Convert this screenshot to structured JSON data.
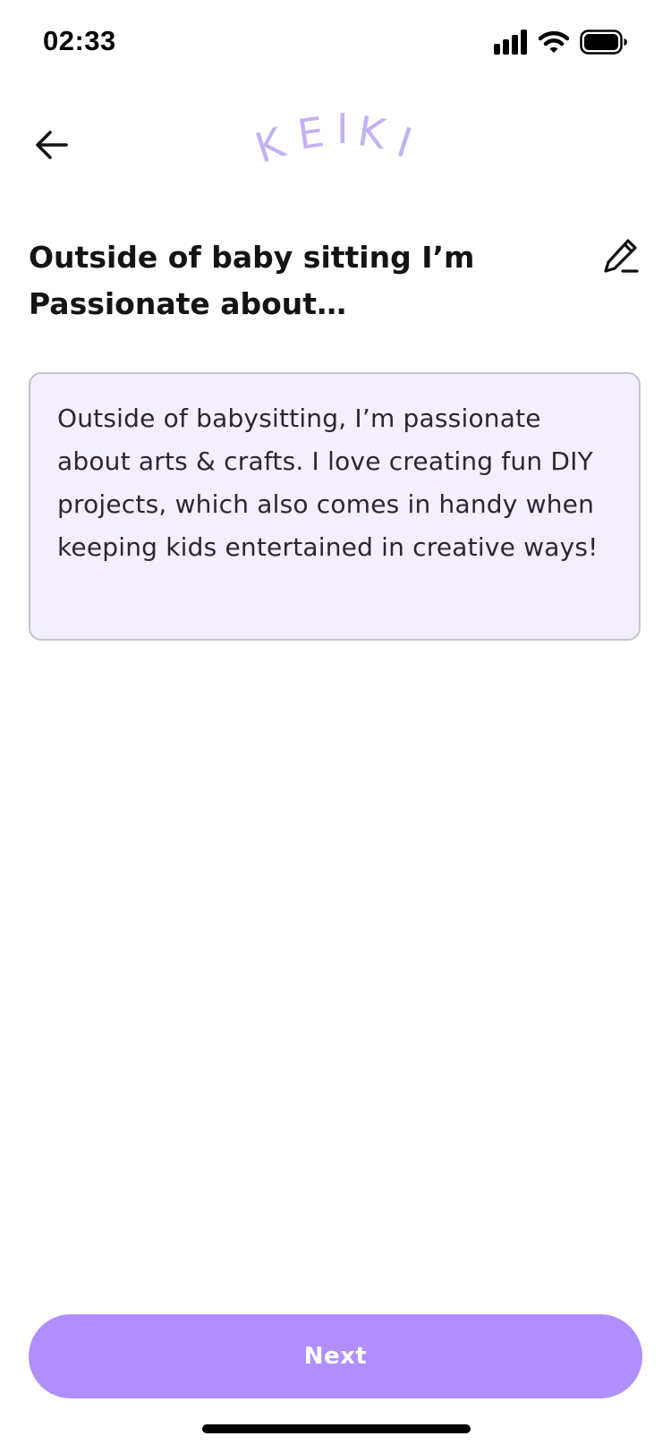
{
  "status_bar": {
    "time": "02:33",
    "icons": [
      "signal-icon",
      "wifi-icon",
      "battery-icon"
    ]
  },
  "header": {
    "back_icon": "back-arrow-icon",
    "logo_text": "KEIKI",
    "logo_color": "#c3b2f2"
  },
  "question": {
    "title": "Outside of baby sitting I’m Passionate about…",
    "edit_icon": "pencil-icon"
  },
  "answer": {
    "text": "Outside of babysitting, I’m passionate about arts & crafts. I love creating fun DIY projects, which also comes in handy when keeping kids entertained in creative ways!",
    "background_color": "#f3effd",
    "border_color": "#c7c2d1"
  },
  "footer": {
    "next_label": "Next",
    "button_color": "#b08ffd"
  }
}
